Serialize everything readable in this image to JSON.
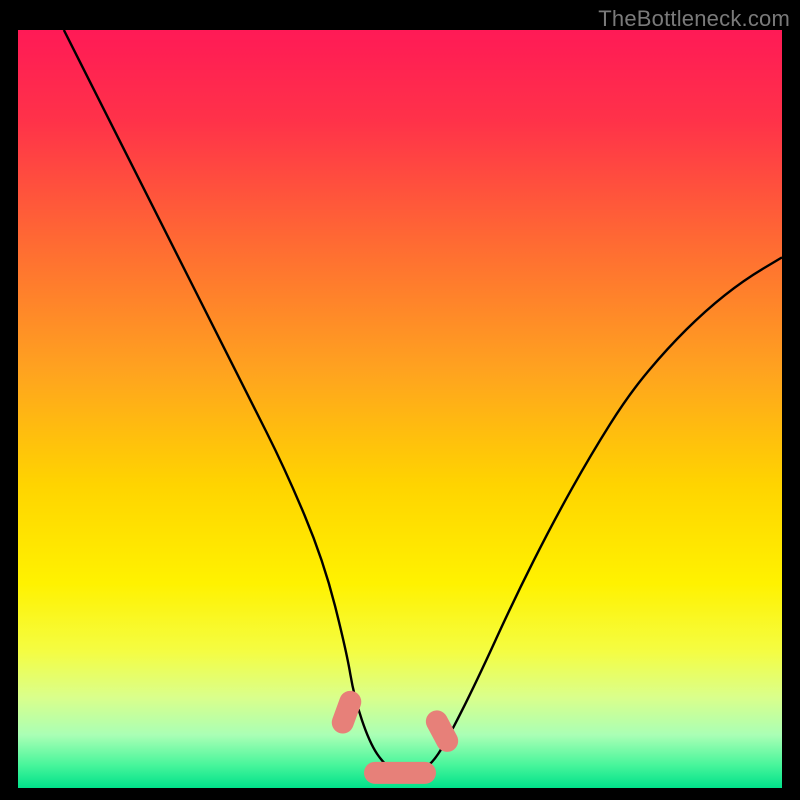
{
  "watermark": "TheBottleneck.com",
  "colors": {
    "frame": "#000000",
    "curve": "#000000",
    "marker": "#e78079",
    "gradient_stops": [
      {
        "offset": 0.0,
        "color": "#ff1a56"
      },
      {
        "offset": 0.12,
        "color": "#ff3249"
      },
      {
        "offset": 0.28,
        "color": "#ff6a33"
      },
      {
        "offset": 0.45,
        "color": "#ffa31f"
      },
      {
        "offset": 0.6,
        "color": "#ffd400"
      },
      {
        "offset": 0.73,
        "color": "#fff200"
      },
      {
        "offset": 0.82,
        "color": "#f4fd43"
      },
      {
        "offset": 0.88,
        "color": "#daff8b"
      },
      {
        "offset": 0.93,
        "color": "#aaffb5"
      },
      {
        "offset": 0.97,
        "color": "#47f59b"
      },
      {
        "offset": 1.0,
        "color": "#00e18a"
      }
    ]
  },
  "chart_data": {
    "type": "line",
    "title": "",
    "xlabel": "",
    "ylabel": "",
    "xlim": [
      0,
      100
    ],
    "ylim": [
      0,
      100
    ],
    "series": [
      {
        "name": "bottleneck-curve",
        "x": [
          6,
          10,
          15,
          20,
          25,
          30,
          35,
          40,
          43,
          44,
          46,
          48,
          50,
          52,
          54,
          56,
          60,
          65,
          70,
          75,
          80,
          85,
          90,
          95,
          100
        ],
        "y": [
          100,
          92,
          82,
          72,
          62,
          52,
          42,
          30,
          18,
          12,
          6,
          3,
          2,
          2,
          3,
          6,
          14,
          25,
          35,
          44,
          52,
          58,
          63,
          67,
          70
        ]
      }
    ],
    "markers": [
      {
        "name": "left-descent-marker",
        "x": 43.0,
        "y": 10.0,
        "angle": -70
      },
      {
        "name": "valley-marker",
        "x": 50.0,
        "y": 2.0,
        "angle": 0
      },
      {
        "name": "right-ascent-marker",
        "x": 55.5,
        "y": 7.5,
        "angle": 62
      }
    ]
  }
}
